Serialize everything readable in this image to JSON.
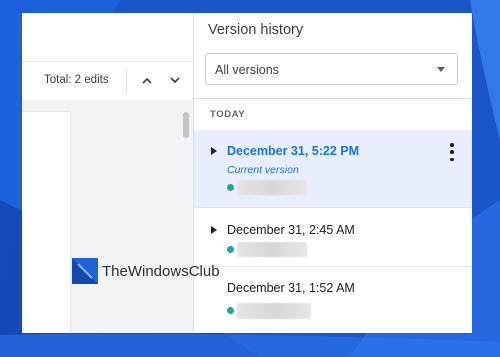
{
  "toolbar": {
    "total_edits": "Total: 2 edits",
    "prev_icon": "chevron-up-icon",
    "next_icon": "chevron-down-icon"
  },
  "panel": {
    "title": "Version history",
    "filter": {
      "selected": "All versions",
      "icon": "dropdown-caret-icon"
    },
    "section_label": "TODAY",
    "versions": [
      {
        "date": "December 31, 5:22 PM",
        "label": "Current version",
        "selected": true,
        "expandable": true
      },
      {
        "date": "December 31, 2:45 AM",
        "selected": false,
        "expandable": true
      },
      {
        "date": "December 31, 1:52 AM",
        "selected": false,
        "expandable": false
      }
    ]
  },
  "watermark": {
    "text": "TheWindowsClub"
  },
  "colors": {
    "accent": "#1a73e8",
    "selected_row": "#e8eefb",
    "editor_dot": "#1ea79c",
    "wallpaper": "#1b56c8"
  }
}
